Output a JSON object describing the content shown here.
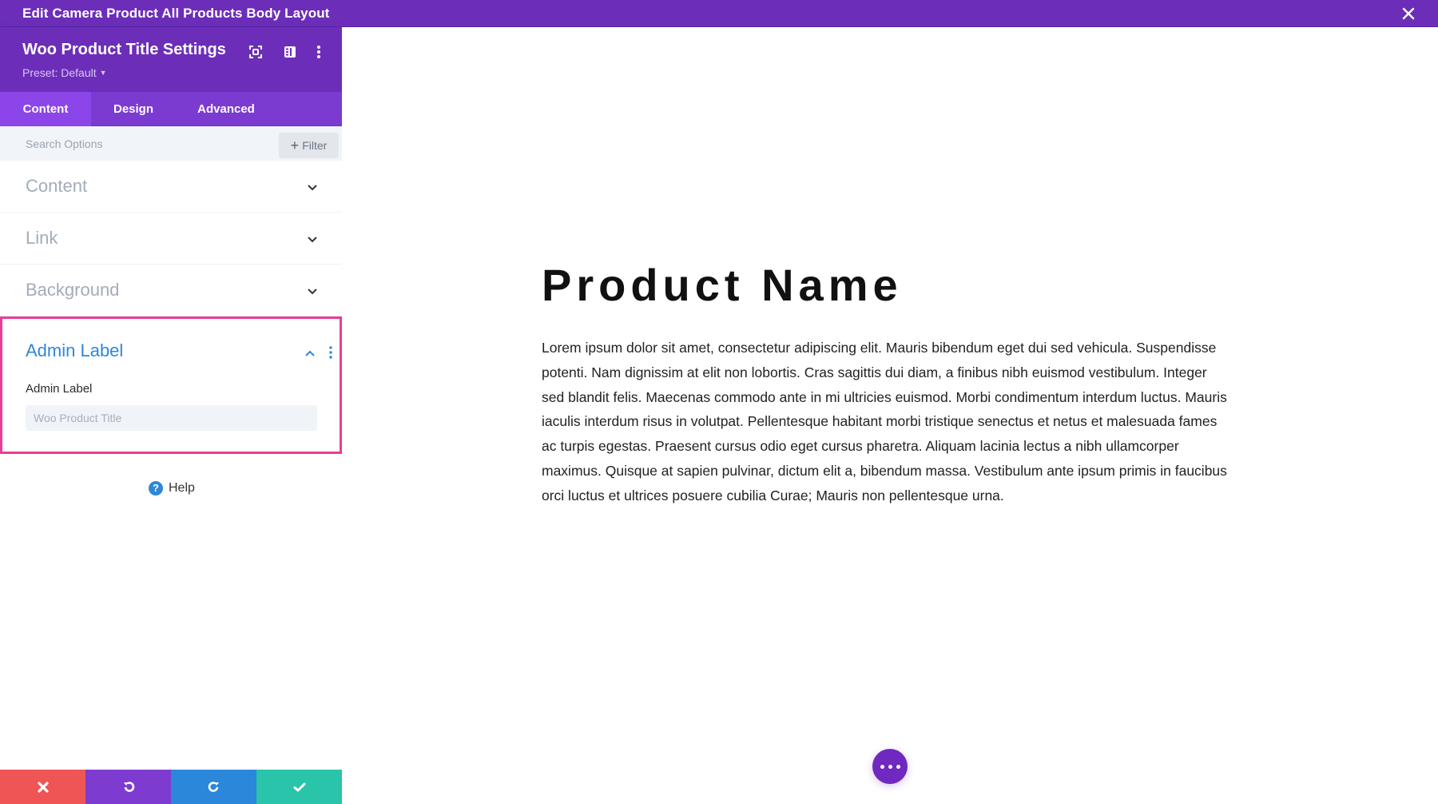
{
  "window": {
    "title": "Edit Camera Product All Products Body Layout",
    "close_icon": "close-icon"
  },
  "panel": {
    "title": "Woo Product Title Settings",
    "preset": "Preset: Default",
    "header_icons": [
      "fullscreen-icon",
      "split-view-icon",
      "kebab-menu-icon"
    ],
    "tabs": [
      {
        "label": "Content",
        "active": true
      },
      {
        "label": "Design",
        "active": false
      },
      {
        "label": "Advanced",
        "active": false
      }
    ],
    "search": {
      "placeholder": "Search Options",
      "value": ""
    },
    "filter_label": "Filter",
    "sections": [
      {
        "label": "Content",
        "expanded": false
      },
      {
        "label": "Link",
        "expanded": false
      },
      {
        "label": "Background",
        "expanded": false
      },
      {
        "label": "Admin Label",
        "expanded": true,
        "highlighted": true
      }
    ],
    "admin_label": {
      "section_title": "Admin Label",
      "field_label": "Admin Label",
      "input_placeholder": "Woo Product Title",
      "input_value": ""
    },
    "help_label": "Help",
    "actions": [
      {
        "name": "cancel",
        "icon": "close-icon",
        "color": "#ef5555"
      },
      {
        "name": "undo",
        "icon": "undo-icon",
        "color": "#7e3bd0"
      },
      {
        "name": "redo",
        "icon": "redo-icon",
        "color": "#2b87da"
      },
      {
        "name": "save",
        "icon": "check-icon",
        "color": "#29c4a9"
      }
    ]
  },
  "canvas": {
    "product_name": "Product Name",
    "description": "Lorem ipsum dolor sit amet, consectetur adipiscing elit. Mauris bibendum eget dui sed vehicula. Suspendisse potenti. Nam dignissim at elit non lobortis. Cras sagittis dui diam, a finibus nibh euismod vestibulum. Integer sed blandit felis. Maecenas commodo ante in mi ultricies euismod. Morbi condimentum interdum luctus. Mauris iaculis interdum risus in volutpat. Pellentesque habitant morbi tristique senectus et netus et malesuada fames ac turpis egestas. Praesent cursus odio eget cursus pharetra. Aliquam lacinia lectus a nibh ullamcorper maximus. Quisque at sapien pulvinar, dictum elit a, bibendum massa. Vestibulum ante ipsum primis in faucibus orci luctus et ultrices posuere cubilia Curae; Mauris non pellentesque urna.",
    "fab_icon": "more-options-icon"
  },
  "colors": {
    "brand_purple": "#6c2eb9",
    "tab_bar": "#7b3bd0",
    "active_tab": "#8c45e8",
    "highlight_border": "#ea3d95",
    "link_blue": "#2e87d8"
  }
}
